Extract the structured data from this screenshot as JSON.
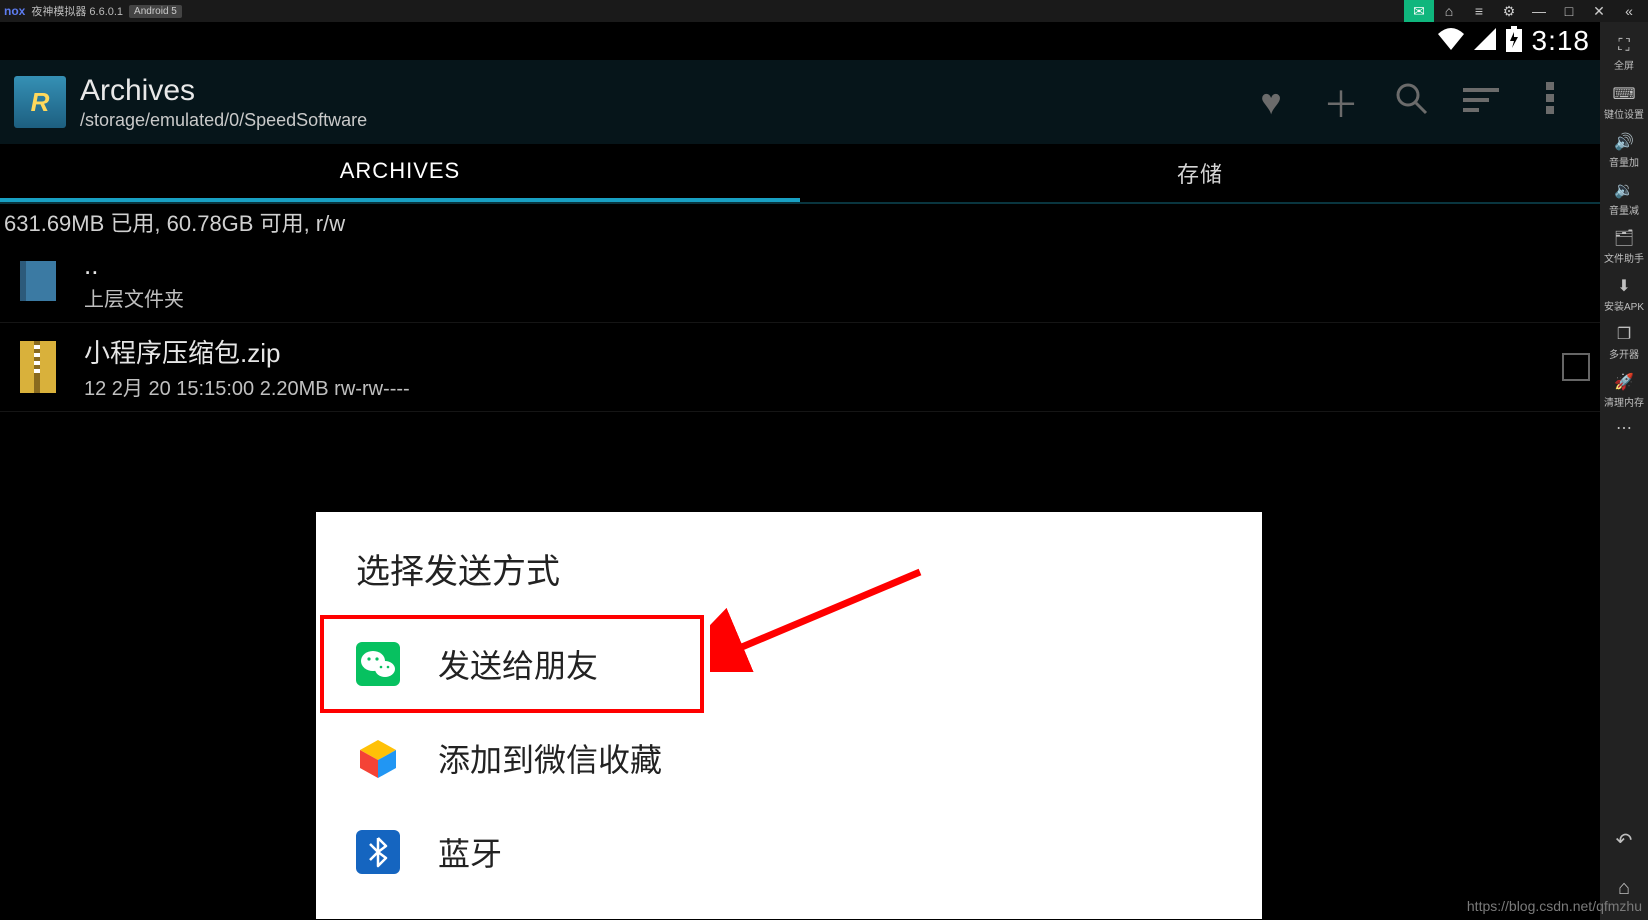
{
  "titlebar": {
    "logo": "nox",
    "name": "夜神模拟器 6.6.0.1",
    "badge": "Android 5"
  },
  "right_tools": {
    "items": [
      {
        "icon": "⛶",
        "label": "全屏"
      },
      {
        "icon": "⌨",
        "label": "键位设置"
      },
      {
        "icon": "🔊+",
        "label": "音量加"
      },
      {
        "icon": "🔊-",
        "label": "音量减"
      },
      {
        "icon": "🗂",
        "label": "文件助手"
      },
      {
        "icon": "⬇",
        "label": "安装APK"
      },
      {
        "icon": "❐",
        "label": "多开器"
      },
      {
        "icon": "🚀",
        "label": "清理内存"
      }
    ]
  },
  "statusbar": {
    "time": "3:18"
  },
  "appbar": {
    "title": "Archives",
    "subtitle": "/storage/emulated/0/SpeedSoftware"
  },
  "tabs": {
    "t1": "ARCHIVES",
    "t2": "存储"
  },
  "storage": "631.69MB 已用, 60.78GB 可用, r/w",
  "rows": {
    "up": {
      "name": "..",
      "meta": "上层文件夹"
    },
    "file1": {
      "name": "小程序压缩包.zip",
      "meta": "12 2月 20 15:15:00  2.20MB   rw-rw----"
    }
  },
  "dialog": {
    "title": "选择发送方式",
    "opts": [
      {
        "label": "发送给朋友"
      },
      {
        "label": "添加到微信收藏"
      },
      {
        "label": "蓝牙"
      }
    ]
  },
  "watermark": "https://blog.csdn.net/qfmzhu"
}
